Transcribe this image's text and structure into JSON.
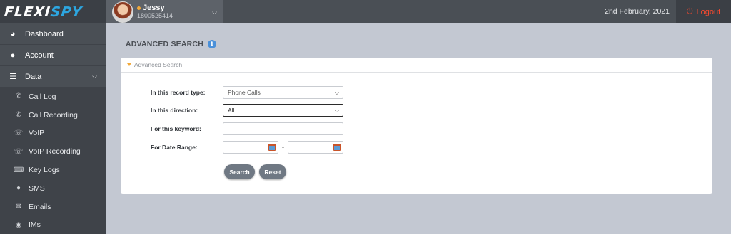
{
  "brand": {
    "logo_left": "FLEXI",
    "logo_right": "SPY"
  },
  "user": {
    "name": "Jessy",
    "phone": "1800525414"
  },
  "header": {
    "date": "2nd February, 2021",
    "logout_label": "Logout"
  },
  "sidebar": {
    "items": [
      {
        "label": "Dashboard",
        "icon": "dashboard-icon"
      },
      {
        "label": "Account",
        "icon": "user-icon"
      },
      {
        "label": "Data",
        "icon": "database-icon"
      }
    ],
    "sub_items": [
      {
        "label": "Call Log",
        "icon": "phone-icon"
      },
      {
        "label": "Call Recording",
        "icon": "phone-recording-icon"
      },
      {
        "label": "VoIP",
        "icon": "voip-icon"
      },
      {
        "label": "VoIP Recording",
        "icon": "voip-recording-icon"
      },
      {
        "label": "Key Logs",
        "icon": "keyboard-icon"
      },
      {
        "label": "SMS",
        "icon": "chat-bubble-icon"
      },
      {
        "label": "Emails",
        "icon": "envelope-icon"
      },
      {
        "label": "IMs",
        "icon": "chat-icon"
      }
    ]
  },
  "page": {
    "title": "ADVANCED SEARCH"
  },
  "panel": {
    "header": "Advanced Search",
    "record_type_label": "In this record type:",
    "record_type_value": "Phone Calls",
    "direction_label": "In this direction:",
    "direction_value": "All",
    "keyword_label": "For this keyword:",
    "keyword_value": "",
    "date_range_label": "For Date Range:",
    "date_separator": "-",
    "search_label": "Search",
    "reset_label": "Reset"
  },
  "colors": {
    "accent_blue": "#2da6e0",
    "logout_red": "#ff4a2e",
    "caret_orange": "#f2a93b"
  }
}
